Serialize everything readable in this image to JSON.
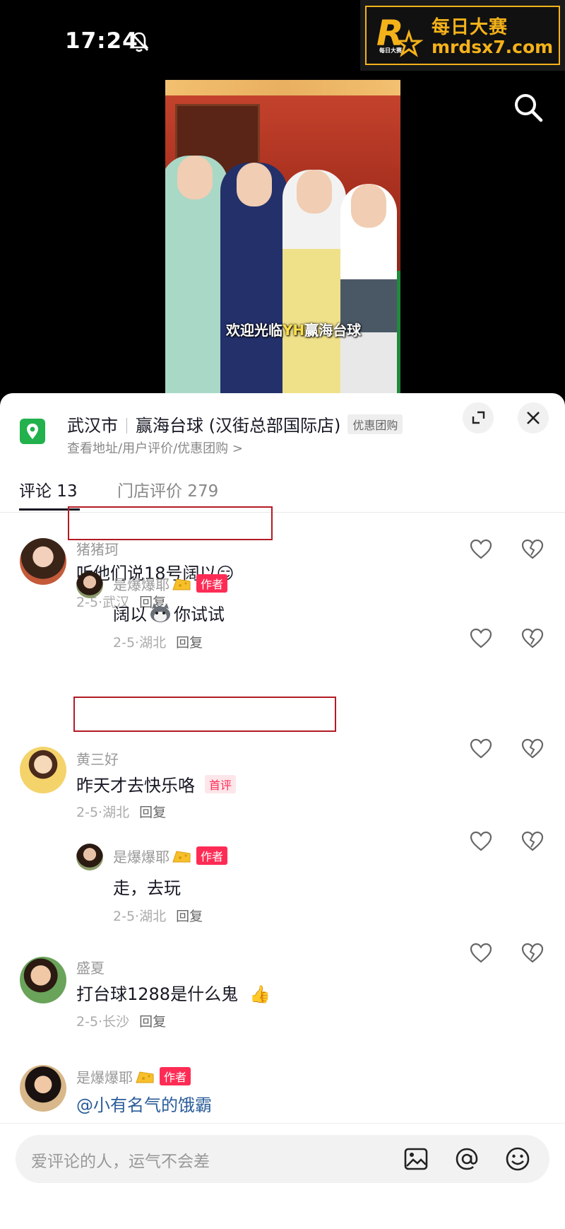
{
  "status_bar": {
    "time": "17:24",
    "icons": [
      "bell-off-icon"
    ]
  },
  "watermark": {
    "logo_letter": "R",
    "logo_small": "每日大赛",
    "line1": "每日大赛",
    "line2": "mrdsx7.com",
    "color": "#f4b21a"
  },
  "video": {
    "caption_prefix": "欢迎光临",
    "caption_highlight": "YH",
    "caption_suffix": "赢海台球"
  },
  "location": {
    "city": "武汉市",
    "shop": "赢海台球 (汉街总部国际店)",
    "badge": "优惠团购",
    "sub": "查看地址/用户评价/优惠团购 >"
  },
  "tabs": [
    {
      "label": "评论 13",
      "active": true
    },
    {
      "label": "门店评价 279",
      "active": false
    }
  ],
  "comments": [
    {
      "user": "猪猪珂",
      "text": "听他们说18号阔以😏",
      "meta": "2-5·武汉",
      "reply": "回复",
      "highlighted": true
    },
    {
      "user": "是爆爆耶",
      "author_tag": "作者",
      "text_a": "阔以",
      "text_b": "你试试",
      "meta": "2-5·湖北",
      "reply": "回复"
    },
    {
      "user": "黄三好",
      "text": "昨天才去快乐咯",
      "first_tag": "首评",
      "meta": "2-5·湖北",
      "reply": "回复",
      "highlighted": true
    },
    {
      "user": "是爆爆耶",
      "author_tag": "作者",
      "text": "走，去玩",
      "meta": "2-5·湖北",
      "reply": "回复"
    },
    {
      "user": "盛夏",
      "text": "打台球1288是什么鬼",
      "emoji": "👍",
      "meta": "2-5·长沙",
      "reply": "回复"
    },
    {
      "user": "是爆爆耶",
      "author_tag": "作者",
      "text": "@小有名气的饿霸"
    }
  ],
  "input": {
    "placeholder": "爱评论的人，运气不会差",
    "icons": [
      "image-icon",
      "at-icon",
      "emoji-icon"
    ]
  },
  "colors": {
    "accent": "#fe2c55",
    "location_green": "#22b14c",
    "highlight_box": "#b31b25"
  }
}
